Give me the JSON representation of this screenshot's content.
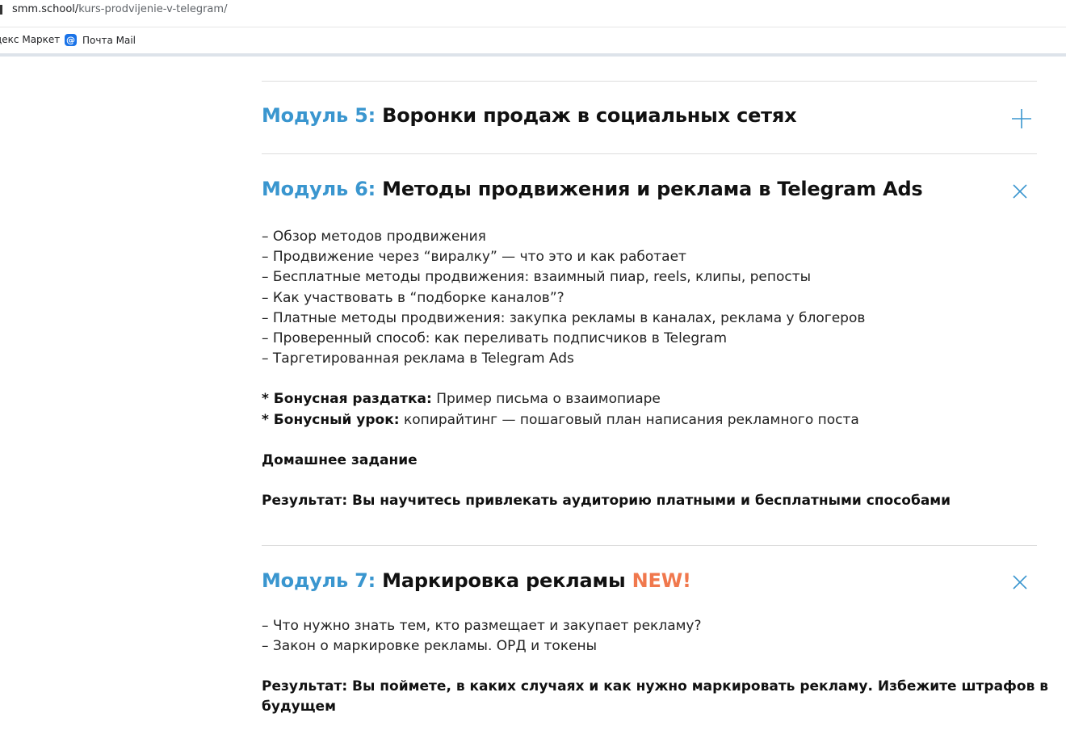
{
  "browser": {
    "url_host": "smm.school/",
    "url_path": "kurs-prodvijenie-v-telegram/",
    "bookmarks": [
      {
        "label": "декс Маркет"
      },
      {
        "label": "Почта Mail",
        "icon": "at-icon"
      }
    ]
  },
  "modules": [
    {
      "number": "Модуль 5:",
      "title": "Воронки продаж в социальных сетях",
      "state_icon": "plus-icon"
    },
    {
      "number": "Модуль 6:",
      "title": "Методы продвижения и реклама в Telegram Ads",
      "state_icon": "close-icon",
      "items": [
        "– Обзор методов продвижения",
        "– Продвижение через “виралку” — что это и как работает",
        "– Бесплатные методы продвижения: взаимный пиар, reels, клипы, репосты",
        "– Как участвовать в “подборке каналов”?",
        "– Платные методы продвижения: закупка рекламы в каналах, реклама у блогеров",
        "– Проверенный способ: как переливать подписчиков в Telegram",
        "– Таргетированная реклама в Telegram Ads"
      ],
      "bonus": [
        {
          "label": "* Бонусная раздатка:",
          "text": " Пример письма о взаимопиаре"
        },
        {
          "label": "* Бонусный урок:",
          "text": " копирайтинг — пошаговый план написания рекламного поста"
        }
      ],
      "homework": "Домашнее задание",
      "result": "Результат: Вы научитесь привлекать аудиторию платными и бесплатными способами"
    },
    {
      "number": "Модуль 7:",
      "title": "Маркировка рекламы",
      "badge": "NEW!",
      "state_icon": "close-icon",
      "items": [
        "– Что нужно знать тем, кто размещает и закупает рекламу?",
        "– Закон о маркировке рекламы. ОРД и токены"
      ],
      "result_line1": "Результат: Вы поймете, в каких случаях и как нужно маркировать рекламу. Избежите штрафов в",
      "result_line2": "будущем"
    }
  ],
  "colors": {
    "module_number": "#3a96cf",
    "new_badge": "#f0784d",
    "icon": "#3a96cf"
  }
}
